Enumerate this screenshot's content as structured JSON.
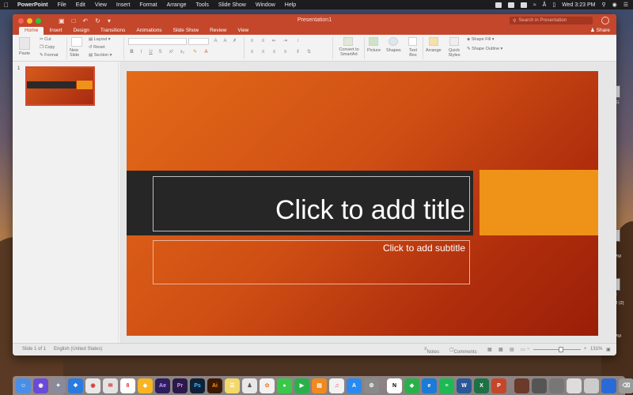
{
  "menubar": {
    "app": "PowerPoint",
    "items": [
      "File",
      "Edit",
      "View",
      "Insert",
      "Format",
      "Arrange",
      "Tools",
      "Slide Show",
      "Window",
      "Help"
    ],
    "clock": "Wed 3:23 PM"
  },
  "window": {
    "title": "Presentation1",
    "search_placeholder": "Search in Presentation",
    "share_label": "Share",
    "accent": "#c4462b"
  },
  "tabs": [
    "Home",
    "Insert",
    "Design",
    "Transitions",
    "Animations",
    "Slide Show",
    "Review",
    "View"
  ],
  "ribbon": {
    "paste": "Paste",
    "cut": "Cut",
    "copy": "Copy",
    "format": "Format",
    "new_slide": "New Slide",
    "layout": "Layout",
    "reset": "Reset",
    "section": "Section",
    "convert_smartart": "Convert to SmartArt",
    "picture": "Picture",
    "shapes": "Shapes",
    "text_box": "Text Box",
    "arrange": "Arrange",
    "quick_styles": "Quick Styles",
    "shape_fill": "Shape Fill",
    "shape_outline": "Shape Outline"
  },
  "slides": {
    "number": "1"
  },
  "slide": {
    "title_placeholder": "Click to add title",
    "subtitle_placeholder": "Click to add subtitle",
    "colors": {
      "background_start": "#e46a18",
      "background_end": "#9a1e08",
      "band": "#262626",
      "accent_box": "#ef9318"
    }
  },
  "status": {
    "slide_count": "Slide 1 of 1",
    "language": "English (United States)",
    "notes": "Notes",
    "comments": "Comments",
    "zoom": "131%"
  },
  "desktop": {
    "labels": [
      "JPG",
      "ot",
      "1 PM",
      "hot",
      "PM (2)",
      "ot",
      "5 PM"
    ]
  },
  "dock": {
    "apps": [
      "finder-icon",
      "siri-icon",
      "launchpad-icon",
      "safari-icon",
      "chrome-icon",
      "mail-icon",
      "calendar-icon",
      "sketch-icon",
      "aftereffects-icon",
      "premiere-icon",
      "photoshop-icon",
      "illustrator-icon",
      "notes-icon",
      "books-icon",
      "photos-icon",
      "messages-icon",
      "facetime-icon",
      "ibooks-icon",
      "music-icon",
      "appstore-icon",
      "preferences-icon",
      "notion-icon",
      "evernote-icon",
      "edge-icon",
      "spotify-icon",
      "word-icon",
      "excel-icon",
      "powerpoint-icon"
    ]
  }
}
